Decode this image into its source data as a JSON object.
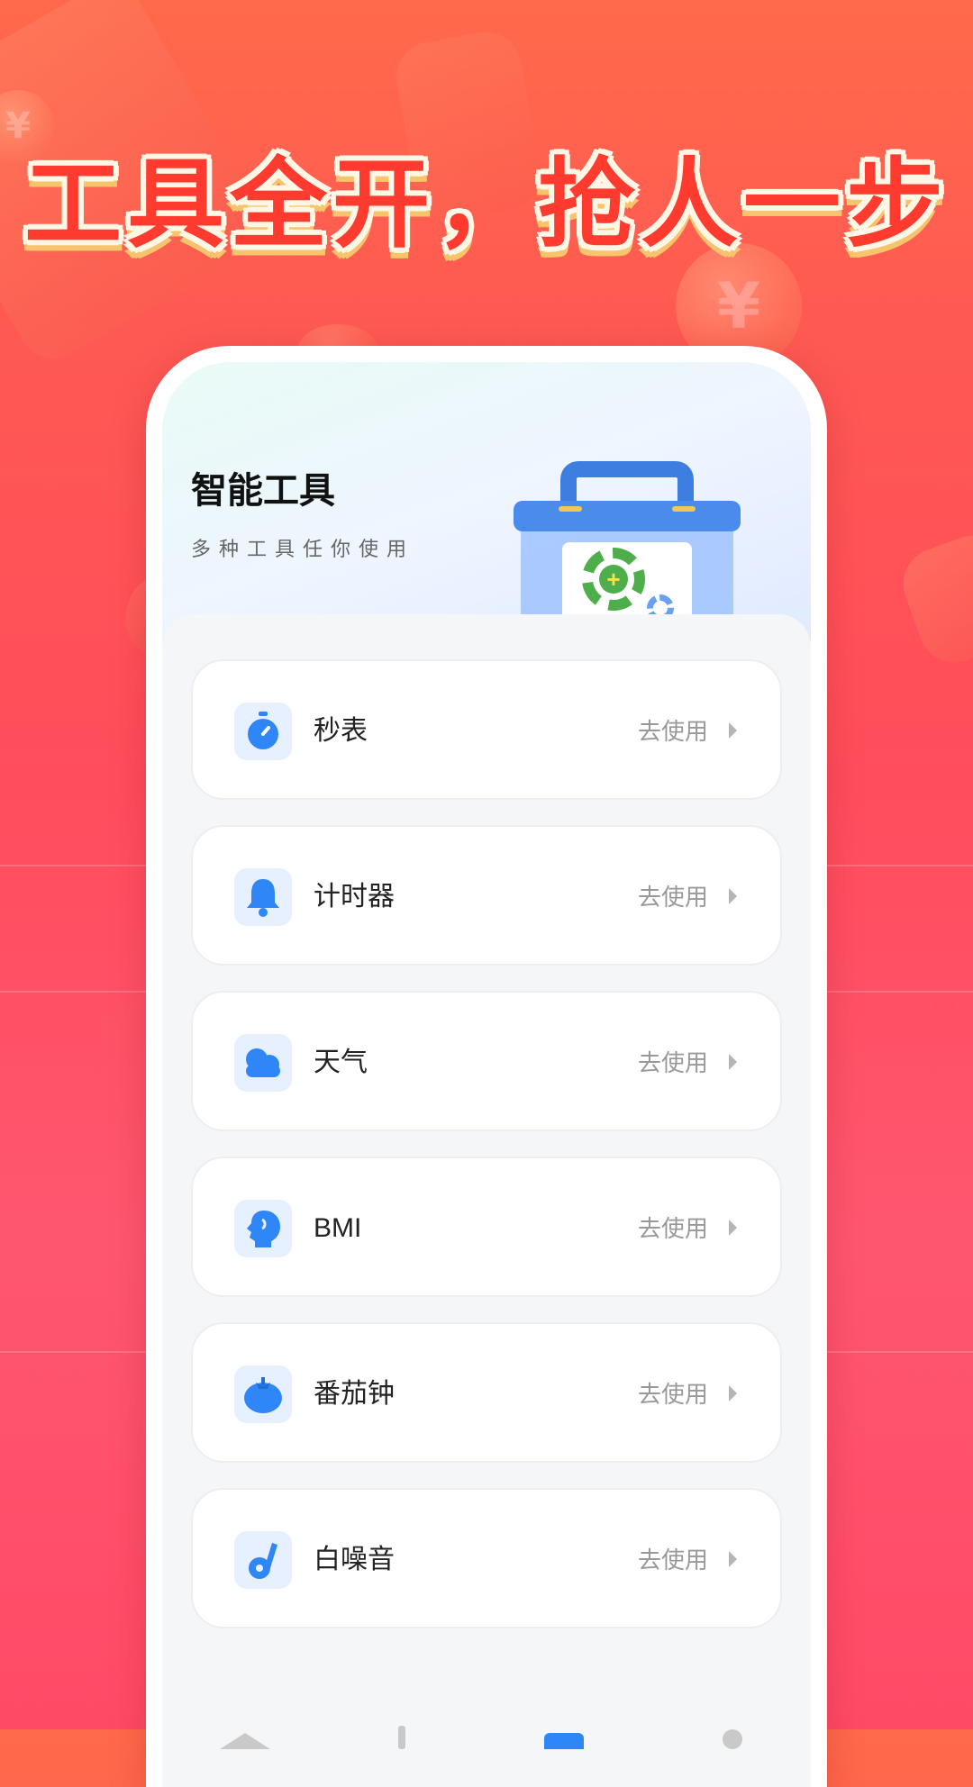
{
  "headline": "工具全开，抢人一步",
  "screen": {
    "title": "智能工具",
    "subtitle": "多种工具任你使用"
  },
  "tools": [
    {
      "name": "秒表",
      "action": "去使用",
      "icon": "stopwatch-icon"
    },
    {
      "name": "计时器",
      "action": "去使用",
      "icon": "bell-icon"
    },
    {
      "name": "天气",
      "action": "去使用",
      "icon": "cloud-icon"
    },
    {
      "name": "BMI",
      "action": "去使用",
      "icon": "head-profile-icon"
    },
    {
      "name": "番茄钟",
      "action": "去使用",
      "icon": "tomato-icon"
    },
    {
      "name": "白噪音",
      "action": "去使用",
      "icon": "music-note-icon"
    }
  ],
  "colors": {
    "background_top": "#ff6a4a",
    "background_bottom": "#ff4a66",
    "headline": "#ff3b2f",
    "icon_blue": "#2f86f6",
    "icon_bg": "#e6f0ff"
  }
}
